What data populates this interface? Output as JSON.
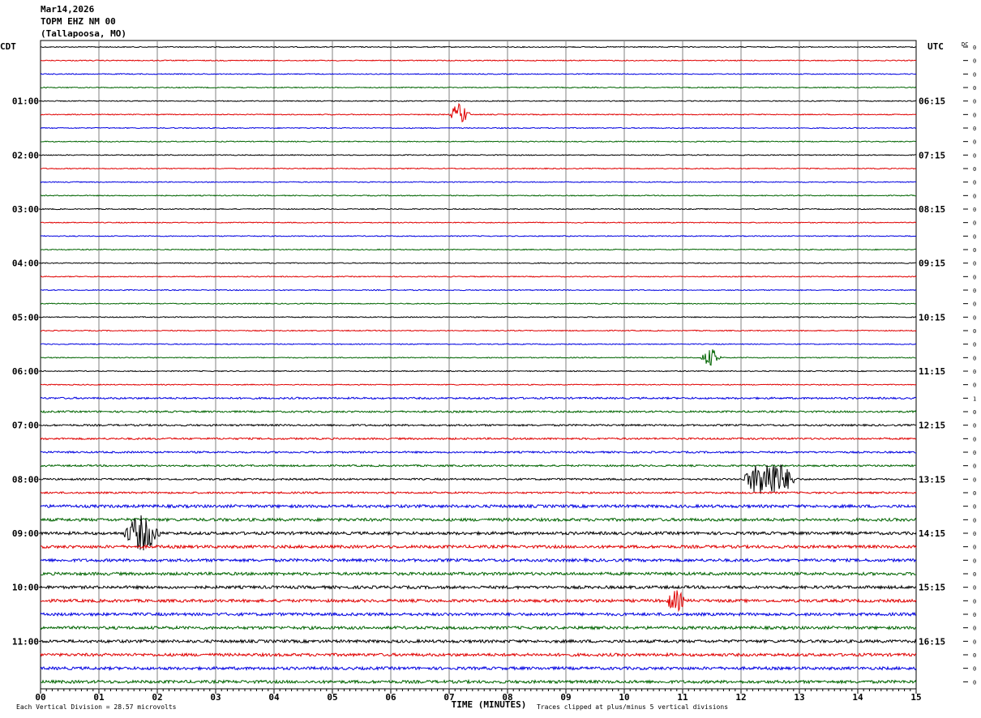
{
  "header": {
    "date": "Mar14,2026",
    "station": "TOPM EHZ NM 00",
    "location": "(Tallapoosa, MO)"
  },
  "chart_data": {
    "type": "line",
    "subtype": "helicorder",
    "left_timezone": "CDT",
    "right_timezone": "UTC",
    "dc_label": "DC",
    "left_time_labels": [
      "01:00",
      "02:00",
      "03:00",
      "04:00",
      "05:00",
      "06:00",
      "07:00",
      "08:00",
      "09:00",
      "10:00",
      "11:00"
    ],
    "right_time_labels": [
      "06:15",
      "07:15",
      "08:15",
      "09:15",
      "10:15",
      "11:15",
      "12:15",
      "13:15",
      "14:15",
      "15:15",
      "16:15"
    ],
    "x_tick_labels": [
      "00",
      "01",
      "02",
      "03",
      "04",
      "05",
      "06",
      "07",
      "08",
      "09",
      "10",
      "11",
      "12",
      "13",
      "14",
      "15"
    ],
    "xlabel": "TIME (MINUTES)",
    "xlim": [
      0,
      15
    ],
    "minutes_per_line": 15,
    "line_count": 48,
    "trace_colors": [
      "#000000",
      "#e00000",
      "#0000e0",
      "#006400"
    ],
    "dc_offsets": [
      "0",
      "0",
      "0",
      "0",
      "0",
      "0",
      "0",
      "0",
      "0",
      "0",
      "0",
      "0",
      "0",
      "0",
      "0",
      "0",
      "0",
      "0",
      "0",
      "0",
      "0",
      "0",
      "0",
      "0",
      "0",
      "0",
      "1",
      "0",
      "0",
      "0",
      "0",
      "0",
      "0",
      "0",
      "0",
      "0",
      "0",
      "0",
      "0",
      "0",
      "0",
      "0",
      "0",
      "0",
      "0",
      "0",
      "0",
      "0"
    ],
    "events": [
      {
        "line": 5,
        "start_min": 7.0,
        "end_min": 7.6,
        "amplitude": 0.55
      },
      {
        "line": 23,
        "start_min": 11.3,
        "end_min": 11.9,
        "amplitude": 0.45
      },
      {
        "line": 32,
        "start_min": 12.0,
        "end_min": 13.6,
        "amplitude": 1.0
      },
      {
        "line": 36,
        "start_min": 1.4,
        "end_min": 2.5,
        "amplitude": 0.9
      },
      {
        "line": 41,
        "start_min": 10.7,
        "end_min": 11.3,
        "amplitude": 0.55
      }
    ],
    "scale_note": "Each Vertical Division =   28.57 microvolts",
    "clip_note": "Traces clipped at plus/minus 5 vertical divisions",
    "grid": true
  }
}
